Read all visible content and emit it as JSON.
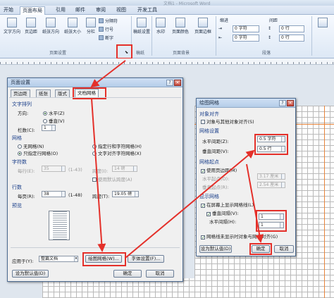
{
  "app": {
    "title_partial": "文档1 - Microsoft Word"
  },
  "ribbon": {
    "tabs": [
      "开始",
      "页面布局",
      "引用",
      "邮件",
      "审阅",
      "视图",
      "开发工具"
    ],
    "page_setup": {
      "text_direction": "文字方向",
      "margins": "页边距",
      "orientation": "纸张方向",
      "size": "纸张大小",
      "columns": "分栏",
      "breaks": "分隔符",
      "line_numbers": "行号",
      "hyphenation": "断字",
      "group_label": "页面设置"
    },
    "manuscript": {
      "label": "稿纸设置",
      "group_label": "稿纸"
    },
    "page_background": {
      "watermark": "水印",
      "page_color": "页面颜色",
      "page_borders": "页面边框",
      "group_label": "页面背景"
    },
    "paragraph": {
      "indent_label": "缩进",
      "left_value": "0 字符",
      "right_value": "0 字符",
      "spacing_label": "间距",
      "before_value": "0 行",
      "after_value": "0 行",
      "group_label": "段落"
    }
  },
  "page_setup_dialog": {
    "title": "页面设置",
    "tabs": [
      "页边距",
      "纸张",
      "版式",
      "文档网格"
    ],
    "text_direction_section": "文字排列",
    "direction_label": "方向:",
    "horizontal": "水平(Z)",
    "vertical": "垂直(V)",
    "columns_label": "栏数(C):",
    "columns_value": "1",
    "grid_section": "网格",
    "no_grid": "无网格(N)",
    "lines_only": "只指定行网格(O)",
    "lines_and_chars": "指定行和字符网格(H)",
    "text_snap": "文字对齐字符网格(X)",
    "chars_section": "字符数",
    "chars_per_line_label": "每行(E):",
    "chars_per_line_value": "35",
    "chars_range": "(1-43)",
    "pitch_label": "跨度(I):",
    "pitch_value": "14 磅",
    "use_default_pitch": "使用默认跨度(A)",
    "lines_section": "行数",
    "lines_per_page_label": "每页(R):",
    "lines_per_page_value": "38",
    "lines_range": "(1-48)",
    "line_pitch_label": "跨度(T):",
    "line_pitch_value": "19.05 磅",
    "preview_section": "预览",
    "apply_to_label": "应用于(Y):",
    "apply_to_value": "整篇文档",
    "drawing_grid_button": "绘图网格(W)...",
    "font_settings_button": "字体设置(F)...",
    "set_default_button": "设为默认值(D)",
    "ok_button": "确定",
    "cancel_button": "取消"
  },
  "drawing_grid_dialog": {
    "title": "绘图网格",
    "object_snap_section": "对象对齐",
    "snap_to_other": "对象与其他对象对齐(S)",
    "grid_settings_section": "网格设置",
    "horizontal_spacing_label": "水平间距(Z):",
    "horizontal_spacing_value": "0.5 字符",
    "vertical_spacing_label": "垂直间距(V):",
    "vertical_spacing_value": "0.5 行",
    "grid_origin_section": "网格起点",
    "use_margins": "使用页边距(M)",
    "horizontal_origin_label": "水平起点(O):",
    "horizontal_origin_value": "3.17 厘米",
    "vertical_origin_label": "垂直起点(R):",
    "vertical_origin_value": "2.54 厘米",
    "show_grid_section": "显示网格",
    "show_gridlines": "在屏幕上显示网格线(L)",
    "vertical_every": "垂直间隔(V):",
    "vertical_every_value": "1",
    "horizontal_every": "水平间隔(H):",
    "horizontal_every_value": "1",
    "snap_when_hidden": "网格线未显示时对象与网格对齐(G)",
    "set_default_button": "设为默认值(D)",
    "ok_button": "确定",
    "cancel_button": "取消"
  },
  "colors": {
    "highlight": "#e4302a",
    "section_text": "#1b3f8a"
  }
}
